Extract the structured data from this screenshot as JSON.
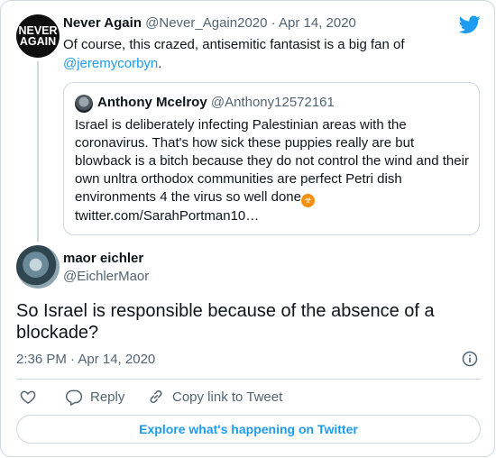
{
  "parent": {
    "avatar_text_top": "NEVER",
    "avatar_text_bottom": "AGAIN",
    "name": "Never Again",
    "handle": "@Never_Again2020",
    "separator": " · ",
    "date": "Apr 14, 2020",
    "text": "Of course, this crazed, antisemitic fantasist is a big fan of",
    "mention": "@jeremycorbyn",
    "mention_suffix": "."
  },
  "quote": {
    "name": "Anthony Mcelroy",
    "handle": "@Anthony12572161",
    "text": "Israel is deliberately infecting Palestinian areas with the coronavirus. That's how sick these puppies really are but blowback is a bitch because they do not control the wind and their own unltra orthodox communities are perfect Petri dish environments 4 the virus  so well done",
    "emoji": "☣",
    "link": "twitter.com/SarahPortman10…"
  },
  "tweet": {
    "name": "maor eichler",
    "handle": "@EichlerMaor",
    "text": "So Israel is responsible because of the absence of a blockade?",
    "time": "2:36 PM · Apr 14, 2020"
  },
  "actions": {
    "reply_label": "Reply",
    "copy_label": "Copy link to Tweet"
  },
  "explore_label": "Explore what's happening on Twitter",
  "icons": [
    "twitter-bird-icon",
    "info-icon",
    "heart-icon",
    "reply-icon",
    "link-icon"
  ],
  "colors": {
    "accent": "#1d9bf0",
    "text": "#0f1419",
    "muted": "#536471",
    "border": "#cfd9de"
  }
}
